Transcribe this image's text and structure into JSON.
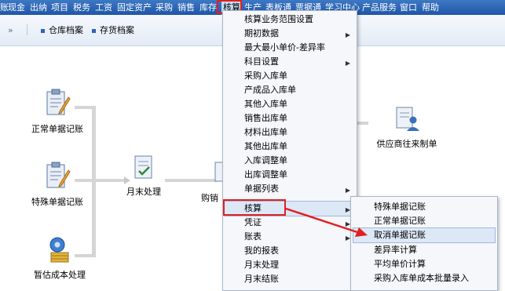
{
  "menubar": {
    "items": [
      "账",
      "现金",
      "出纳",
      "项目",
      "税务",
      "工资",
      "固定资产",
      "采购",
      "销售",
      "库存",
      "核算",
      "生产",
      "表板通",
      "票据通",
      "学习中心",
      "产品服务",
      "窗口",
      "帮助"
    ]
  },
  "toolbar": {
    "nav": "»",
    "buttons": [
      "仓库档案",
      "存货档案"
    ]
  },
  "flow": {
    "nodes": [
      "正常单据记账",
      "特殊单据记账",
      "暂估成本处理",
      "月末处理",
      "购销",
      "供应商往来制单"
    ]
  },
  "dropdown": {
    "items": [
      {
        "label": "核算业务范围设置",
        "submenu": false
      },
      {
        "label": "期初数据",
        "submenu": true
      },
      {
        "label": "最大最小单价-差异率",
        "submenu": false
      },
      {
        "label": "科目设置",
        "submenu": true
      },
      {
        "label": "采购入库单",
        "submenu": false
      },
      {
        "label": "产成品入库单",
        "submenu": false
      },
      {
        "label": "其他入库单",
        "submenu": false
      },
      {
        "label": "销售出库单",
        "submenu": false
      },
      {
        "label": "材料出库单",
        "submenu": false
      },
      {
        "label": "其他出库单",
        "submenu": false
      },
      {
        "label": "入库调整单",
        "submenu": false
      },
      {
        "label": "出库调整单",
        "submenu": false
      },
      {
        "label": "单据列表",
        "submenu": true
      },
      {
        "label": "核算",
        "submenu": true
      },
      {
        "label": "凭证",
        "submenu": true
      },
      {
        "label": "账表",
        "submenu": true
      },
      {
        "label": "我的报表",
        "submenu": false
      },
      {
        "label": "月末处理",
        "submenu": false
      },
      {
        "label": "月末结账",
        "submenu": false
      }
    ],
    "highlighted": "核算"
  },
  "submenu": {
    "items": [
      "特殊单据记账",
      "正常单据记账",
      "取消单据记账",
      "差异率计算",
      "平均单价计算",
      "采购入库单成本批量录入"
    ],
    "highlighted": "取消单据记账"
  },
  "colors": {
    "menubar": "#2a63b3",
    "highlight": "#dde8f6",
    "annotation": "#e02020"
  }
}
